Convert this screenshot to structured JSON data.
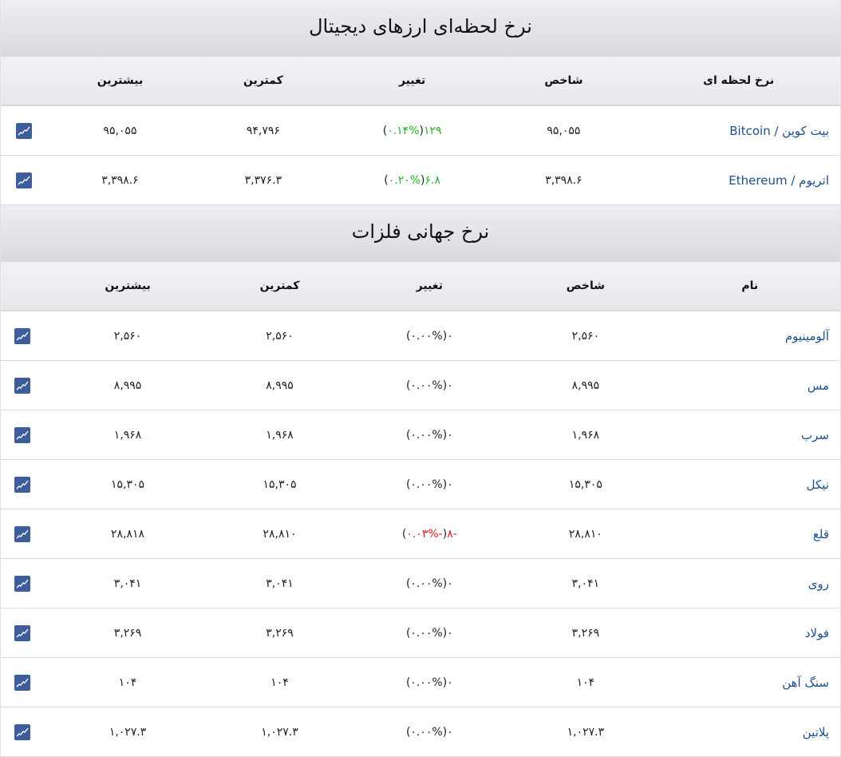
{
  "crypto": {
    "title": "نرخ لحظه‌ای ارزهای دیجیتال",
    "headers": {
      "name": "نرخ لحظه ای",
      "index": "شاخص",
      "change": "تغییر",
      "low": "کمترین",
      "high": "بیشترین"
    },
    "rows": [
      {
        "name": "بیت کوین / Bitcoin",
        "index": "۹۵,۰۵۵",
        "change": "۱۲۹",
        "change_pct": "۰.۱۴%",
        "direction": "up",
        "low": "۹۴,۷۹۶",
        "high": "۹۵,۰۵۵"
      },
      {
        "name": "اتریوم / Ethereum",
        "index": "۳,۳۹۸.۶",
        "change": "۶.۸",
        "change_pct": "۰.۲۰%",
        "direction": "up",
        "low": "۳,۳۷۶.۳",
        "high": "۳,۳۹۸.۶"
      }
    ]
  },
  "metals": {
    "title": "نرخ جهانی فلزات",
    "headers": {
      "name": "نام",
      "index": "شاخص",
      "change": "تغییر",
      "low": "کمترین",
      "high": "بیشترین"
    },
    "rows": [
      {
        "name": "آلومینیوم",
        "index": "۲,۵۶۰",
        "change": "۰",
        "change_pct": "۰.۰۰%",
        "direction": "flat",
        "low": "۲,۵۶۰",
        "high": "۲,۵۶۰"
      },
      {
        "name": "مس",
        "index": "۸,۹۹۵",
        "change": "۰",
        "change_pct": "۰.۰۰%",
        "direction": "flat",
        "low": "۸,۹۹۵",
        "high": "۸,۹۹۵"
      },
      {
        "name": "سرب",
        "index": "۱,۹۶۸",
        "change": "۰",
        "change_pct": "۰.۰۰%",
        "direction": "flat",
        "low": "۱,۹۶۸",
        "high": "۱,۹۶۸"
      },
      {
        "name": "نیکل",
        "index": "۱۵,۳۰۵",
        "change": "۰",
        "change_pct": "۰.۰۰%",
        "direction": "flat",
        "low": "۱۵,۳۰۵",
        "high": "۱۵,۳۰۵"
      },
      {
        "name": "قلع",
        "index": "۲۸,۸۱۰",
        "change": "-۸",
        "change_pct": "-۰.۰۳%",
        "direction": "down",
        "low": "۲۸,۸۱۰",
        "high": "۲۸,۸۱۸"
      },
      {
        "name": "روی",
        "index": "۳,۰۴۱",
        "change": "۰",
        "change_pct": "۰.۰۰%",
        "direction": "flat",
        "low": "۳,۰۴۱",
        "high": "۳,۰۴۱"
      },
      {
        "name": "فولاد",
        "index": "۳,۲۶۹",
        "change": "۰",
        "change_pct": "۰.۰۰%",
        "direction": "flat",
        "low": "۳,۲۶۹",
        "high": "۳,۲۶۹"
      },
      {
        "name": "سنگ آهن",
        "index": "۱۰۴",
        "change": "۰",
        "change_pct": "۰.۰۰%",
        "direction": "flat",
        "low": "۱۰۴",
        "high": "۱۰۴"
      },
      {
        "name": "پلاتین",
        "index": "۱,۰۲۷.۳",
        "change": "۰",
        "change_pct": "۰.۰۰%",
        "direction": "flat",
        "low": "۱,۰۲۷.۳",
        "high": "۱,۰۲۷.۳"
      }
    ]
  },
  "colors": {
    "up": "#22b522",
    "down": "#e21b1b",
    "link": "#1d4f8e",
    "icon_bg": "#3d5d9b"
  },
  "icon": "chart-line-icon"
}
